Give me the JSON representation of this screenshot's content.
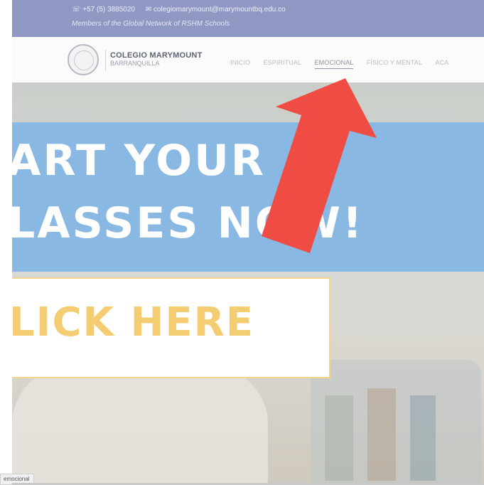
{
  "topbar": {
    "phone": "☏ +57 (5) 3885020",
    "email": "✉ colegiomarymount@marymountbq.edu.co",
    "tagline": "Members of the Global Network of RSHM Schools"
  },
  "brand": {
    "name": "COLEGIO MARYMOUNT",
    "city": "BARRANQUILLA"
  },
  "nav": {
    "items": [
      "INICIO",
      "ESPIRITUAL",
      "EMOCIONAL",
      "FÍSICO Y MENTAL",
      "ACA"
    ],
    "active_index": 2
  },
  "hero": {
    "line1": "ART YOUR",
    "line2": "LASSES NOW!",
    "cta": "LICK HERE"
  },
  "status_bar": {
    "text": "emocional"
  },
  "colors": {
    "topbar": "#8f98c2",
    "banner": "#89b9e2",
    "cta_text": "#f4cd72",
    "arrow": "#ef4d43"
  }
}
